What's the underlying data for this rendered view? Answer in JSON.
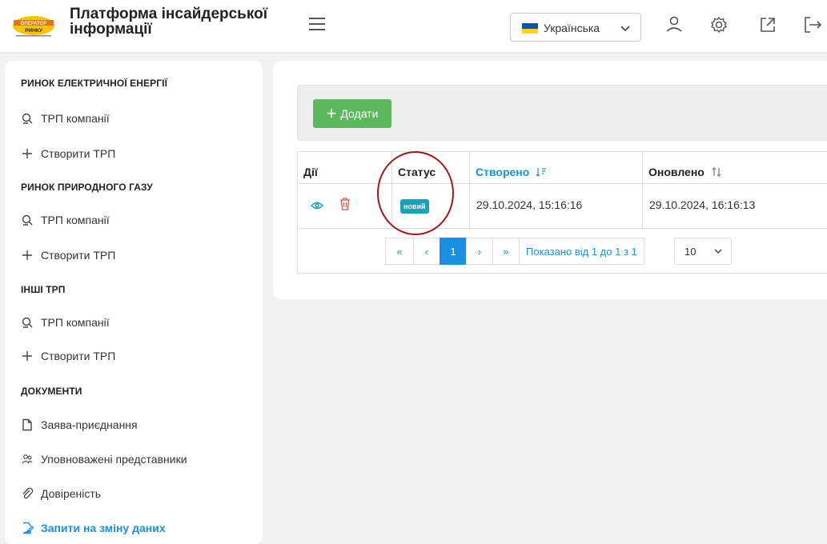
{
  "header": {
    "logo_text": "ОПЕРАТОР РИНКУ",
    "title": "Платформа інсайдерської\nінформації",
    "language": "Українська",
    "icons": [
      "menu-icon",
      "user-icon",
      "gear-icon",
      "external-link-icon",
      "logout-icon"
    ],
    "colors": {
      "brand_orange": "#e8701a",
      "brand_yellow": "#f6c400"
    }
  },
  "sidebar": {
    "sections": [
      {
        "title": "РИНОК ЕЛЕКТРИЧНОЇ ЕНЕРГІЇ",
        "items": [
          {
            "label": "ТРП компанії",
            "icon": "search-doc-icon"
          },
          {
            "label": "Створити ТРП",
            "icon": "plus-icon"
          }
        ]
      },
      {
        "title": "РИНОК ПРИРОДНОГО ГАЗУ",
        "items": [
          {
            "label": "ТРП компанії",
            "icon": "search-doc-icon"
          },
          {
            "label": "Створити ТРП",
            "icon": "plus-icon"
          }
        ]
      },
      {
        "title": "ІНШІ ТРП",
        "items": [
          {
            "label": "ТРП компанії",
            "icon": "search-doc-icon"
          },
          {
            "label": "Створити ТРП",
            "icon": "plus-icon"
          }
        ]
      },
      {
        "title": "ДОКУМЕНТИ",
        "items": [
          {
            "label": "Заява-приєднання",
            "icon": "file-icon"
          },
          {
            "label": "Уповноважені представники",
            "icon": "users-icon"
          },
          {
            "label": "Довіреність",
            "icon": "paperclip-icon"
          },
          {
            "label": "Запити на зміну даних",
            "icon": "edit-file-icon",
            "active": true
          }
        ]
      }
    ],
    "active_color": "#1a8fe3"
  },
  "main": {
    "add_button": "Додати",
    "table": {
      "columns": [
        "Дії",
        "Статус",
        "Створено",
        "Оновлено"
      ],
      "rows": [
        {
          "status": "новий",
          "created": "29.10.2024, 15:16:16",
          "updated": "29.10.2024, 16:16:13"
        }
      ]
    },
    "pagination": {
      "first": "«",
      "prev": "‹",
      "current": "1",
      "next": "›",
      "last": "»",
      "info": "Показано від 1 до 1 з 1",
      "page_size": "10"
    },
    "colors": {
      "add_green": "#5cb85c",
      "badge_teal": "#16a2b8",
      "link_blue": "#1a8fe3",
      "delete_red": "#d9534f",
      "highlight_circle": "#a4161a"
    }
  }
}
